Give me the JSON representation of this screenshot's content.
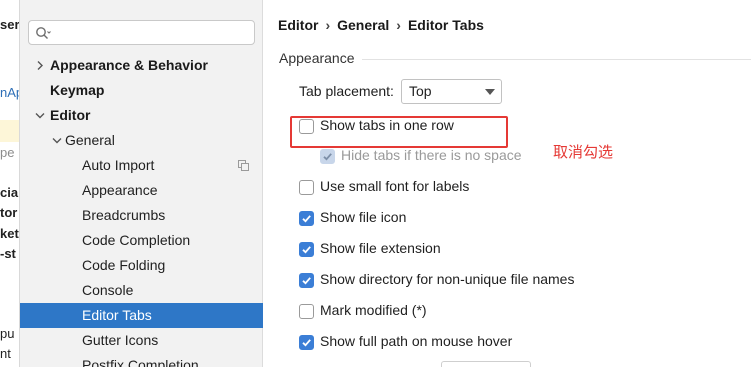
{
  "background_editor": {
    "fragments": [
      "ser",
      "nAp",
      "pe",
      "cial",
      "tor",
      "ket",
      "-st",
      "pu",
      "nt"
    ]
  },
  "tree": {
    "search": {
      "placeholder": "",
      "value": ""
    },
    "items": [
      {
        "label": "Appearance & Behavior",
        "level": 0,
        "bold": true,
        "expand": "collapsed"
      },
      {
        "label": "Keymap",
        "level": 0,
        "bold": true,
        "expand": "none"
      },
      {
        "label": "Editor",
        "level": 0,
        "bold": true,
        "expand": "expanded"
      },
      {
        "label": "General",
        "level": 1,
        "bold": false,
        "expand": "expanded"
      },
      {
        "label": "Auto Import",
        "level": 2,
        "bold": false,
        "expand": "none",
        "copy_icon": true
      },
      {
        "label": "Appearance",
        "level": 2,
        "bold": false,
        "expand": "none"
      },
      {
        "label": "Breadcrumbs",
        "level": 2,
        "bold": false,
        "expand": "none"
      },
      {
        "label": "Code Completion",
        "level": 2,
        "bold": false,
        "expand": "none"
      },
      {
        "label": "Code Folding",
        "level": 2,
        "bold": false,
        "expand": "none"
      },
      {
        "label": "Console",
        "level": 2,
        "bold": false,
        "expand": "none"
      },
      {
        "label": "Editor Tabs",
        "level": 2,
        "bold": false,
        "expand": "none",
        "selected": true
      },
      {
        "label": "Gutter Icons",
        "level": 2,
        "bold": false,
        "expand": "none"
      },
      {
        "label": "Postfix Completion",
        "level": 2,
        "bold": false,
        "expand": "none"
      }
    ],
    "selection_color": "#2e77c7"
  },
  "breadcrumb": [
    "Editor",
    "General",
    "Editor Tabs"
  ],
  "breadcrumb_separator": "›",
  "section": {
    "title": "Appearance"
  },
  "tab_placement": {
    "label": "Tab placement:",
    "value": "Top"
  },
  "options": [
    {
      "label": "Show tabs in one row",
      "checked": false,
      "disabled": false
    },
    {
      "label": "Hide tabs if there is no space",
      "checked": true,
      "disabled": true
    },
    {
      "label": "Use small font for labels",
      "checked": false,
      "disabled": false
    },
    {
      "label": "Show file icon",
      "checked": true,
      "disabled": false
    },
    {
      "label": "Show file extension",
      "checked": true,
      "disabled": false
    },
    {
      "label": "Show directory for non-unique file names",
      "checked": true,
      "disabled": false
    },
    {
      "label": "Mark modified (*)",
      "checked": false,
      "disabled": false
    },
    {
      "label": "Show full path on mouse hover",
      "checked": true,
      "disabled": false
    }
  ],
  "annotation": {
    "note": "取消勾选",
    "color": "#e53935"
  },
  "colors": {
    "checkbox_on": "#3b7ed6",
    "accent": "#2e77c7"
  }
}
